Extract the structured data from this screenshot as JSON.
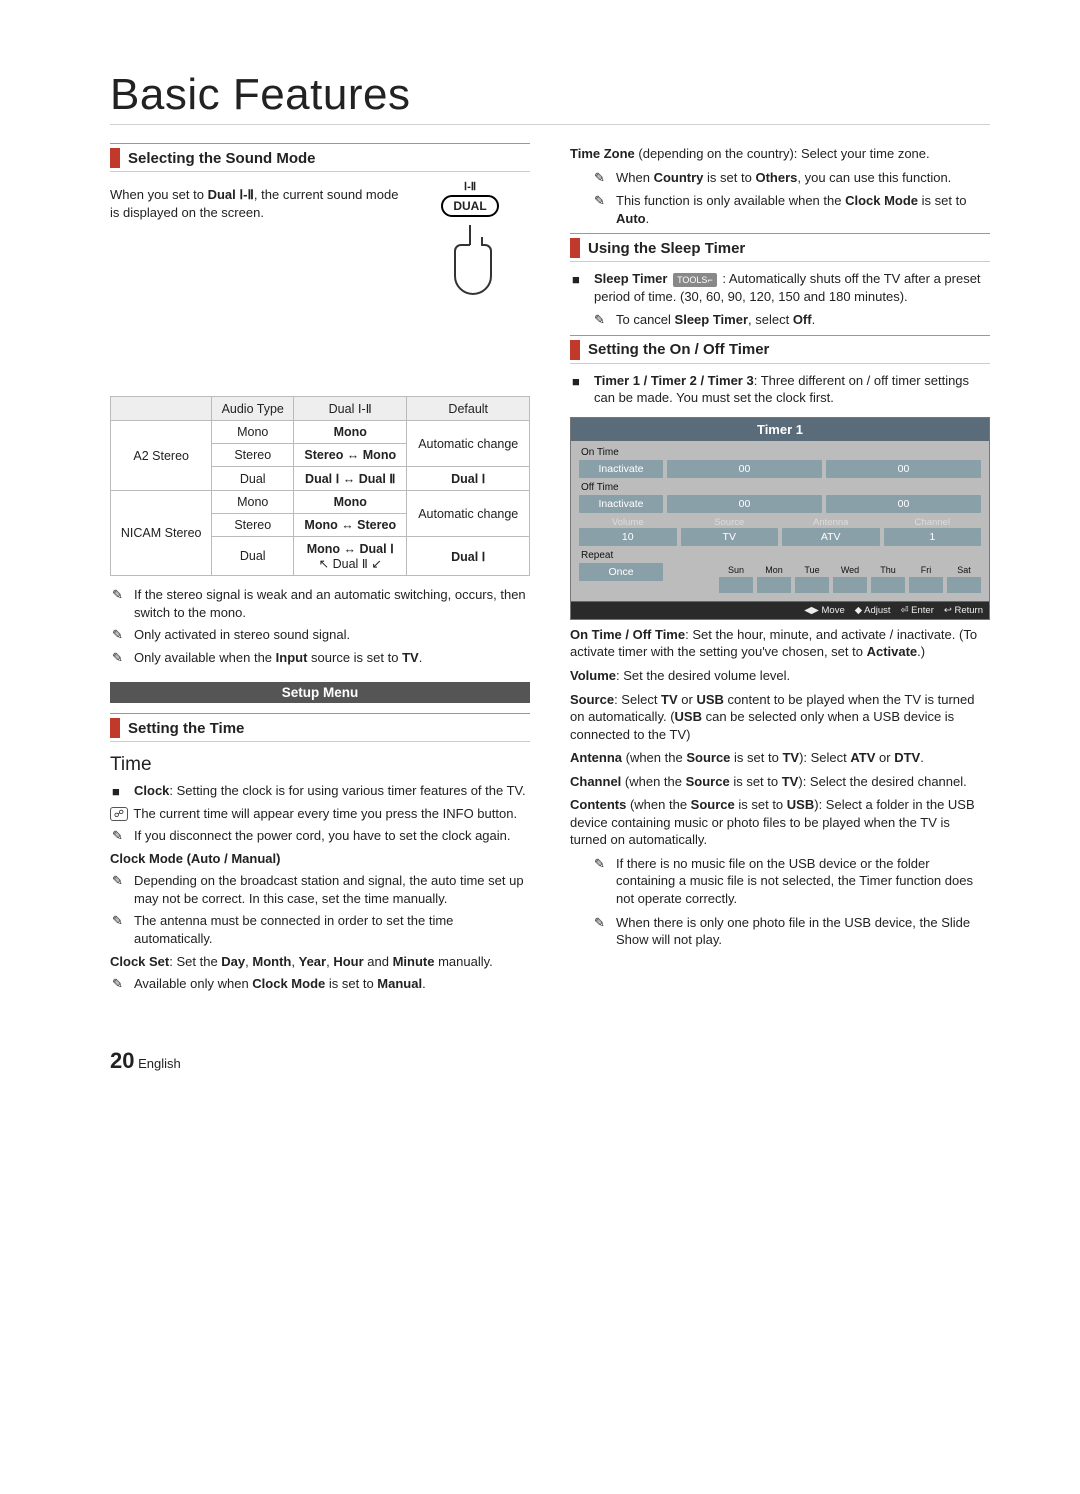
{
  "page": {
    "title": "Basic Features",
    "number": "20",
    "language": "English"
  },
  "dual": {
    "heading": "Selecting the Sound Mode",
    "intro_pre": "When you set to ",
    "intro_bold": "Dual Ⅰ-Ⅱ",
    "intro_post": ", the current sound mode is displayed on the screen.",
    "remote_caption": "Ⅰ-Ⅱ",
    "remote_button": "DUAL",
    "table": {
      "h1": "Audio Type",
      "h2": "Dual Ⅰ-Ⅱ",
      "h3": "Default",
      "sys1": "A2 Stereo",
      "sys2": "NICAM Stereo",
      "r1_at": "Mono",
      "r1_d": "Mono",
      "r1_def": "Automatic change",
      "r2_at": "Stereo",
      "r2_d": "Stereo ↔ Mono",
      "r3_at": "Dual",
      "r3_d": "Dual Ⅰ ↔ Dual Ⅱ",
      "r3_def": "Dual Ⅰ",
      "r4_at": "Mono",
      "r4_d": "Mono",
      "r4_def": "Automatic change",
      "r5_at": "Stereo",
      "r5_d": "Mono ↔ Stereo",
      "r6_at": "Dual",
      "r6_d1": "Mono ↔ Dual Ⅰ",
      "r6_d2": "↖ Dual Ⅱ ↙",
      "r6_def": "Dual Ⅰ"
    },
    "n1": "If the stereo signal is weak and an automatic switching, occurs, then switch to the mono.",
    "n2": "Only activated in stereo sound signal.",
    "n3_pre": "Only available when the ",
    "n3_b": "Input",
    "n3_mid": " source is set to ",
    "n3_b2": "TV",
    "n3_post": "."
  },
  "setup": {
    "banner": "Setup Menu",
    "setting_time": "Setting the Time",
    "time_h": "Time",
    "clock_b": "Clock",
    "clock_txt": ": Setting the clock is for using various timer features of the TV.",
    "info_n": "The current time will appear every time you press the INFO button.",
    "disc_n": "If you disconnect the power cord, you have to set the clock again.",
    "cmode_b": "Clock Mode (Auto / Manual)",
    "cmode_n1": "Depending on the broadcast station and signal, the auto time set up may not be correct. In this case, set the time manually.",
    "cmode_n2": "The antenna must be connected in order to set the time automatically.",
    "cset_pre": "Clock Set",
    "cset_txt1": ": Set the ",
    "cset_day": "Day",
    "cset_c1": ", ",
    "cset_month": "Month",
    "cset_c2": ", ",
    "cset_year": "Year",
    "cset_c3": ", ",
    "cset_hour": "Hour",
    "cset_c4": " and ",
    "cset_min": "Minute",
    "cset_txt2": " manually.",
    "cset_n_pre": "Available only when ",
    "cset_n_b": "Clock Mode",
    "cset_n_mid": " is set to ",
    "cset_n_b2": "Manual",
    "cset_n_post": "."
  },
  "tz": {
    "l1_b": "Time Zone",
    "l1_txt": " (depending on the country): Select your time zone.",
    "n1_pre": "When ",
    "n1_b1": "Country",
    "n1_mid": " is set to ",
    "n1_b2": "Others",
    "n1_post": ", you can use this function.",
    "n2_pre": "This function is only available when the ",
    "n2_b": "Clock Mode",
    "n2_mid": " is set to ",
    "n2_b2": "Auto",
    "n2_post": "."
  },
  "sleep": {
    "heading": "Using the Sleep Timer",
    "b1": "Sleep Timer",
    "tools": "TOOLS⌐",
    "txt": ": Automatically shuts off the TV after a preset period of time. (30, 60, 90, 120, 150 and 180 minutes).",
    "n_pre": "To cancel ",
    "n_b": "Sleep Timer",
    "n_mid": ", select ",
    "n_b2": "Off",
    "n_post": "."
  },
  "onoff": {
    "heading": "Setting the On / Off Timer",
    "b1": "Timer 1 / Timer 2 / Timer 3",
    "b1_txt": ": Three different on / off timer settings can be made. You must set the clock first.",
    "osd": {
      "title": "Timer 1",
      "ontime": "On Time",
      "offtime": "Off Time",
      "inactivate": "Inactivate",
      "zero": "00",
      "volume": "Volume",
      "source": "Source",
      "antenna": "Antenna",
      "channel": "Channel",
      "v_vol": "10",
      "v_src": "TV",
      "v_ant": "ATV",
      "v_ch": "1",
      "repeat": "Repeat",
      "once": "Once",
      "days": [
        "Sun",
        "Mon",
        "Tue",
        "Wed",
        "Thu",
        "Fri",
        "Sat"
      ],
      "legend_move": "◀▶ Move",
      "legend_adj": "◆ Adjust",
      "legend_enter": "⏎ Enter",
      "legend_ret": "↩ Return"
    },
    "p_onoff_b": "On Time / Off Time",
    "p_onoff_t": ": Set the hour, minute, and activate / inactivate. (To activate timer with the setting you've chosen, set to ",
    "p_onoff_b2": "Activate",
    "p_onoff_t2": ".)",
    "p_vol_b": "Volume",
    "p_vol_t": ": Set the desired volume level.",
    "p_src_b": "Source",
    "p_src_t": ": Select ",
    "p_src_b2": "TV",
    "p_src_t2": " or ",
    "p_src_b3": "USB",
    "p_src_t3": " content to be played when the TV is turned on automatically. (",
    "p_src_b4": "USB",
    "p_src_t4": " can be selected only when a USB device is connected to the TV)",
    "p_ant_b": "Antenna",
    "p_ant_t": " (when the ",
    "p_ant_b2": "Source",
    "p_ant_t2": " is set to ",
    "p_ant_b3": "TV",
    "p_ant_t3": "): Select ",
    "p_ant_b4": "ATV",
    "p_ant_t4": " or ",
    "p_ant_b5": "DTV",
    "p_ant_t5": ".",
    "p_ch_b": "Channel",
    "p_ch_t": " (when the ",
    "p_ch_b2": "Source",
    "p_ch_t2": " is set to ",
    "p_ch_b3": "TV",
    "p_ch_t3": "): Select the desired channel.",
    "p_ct_b": "Contents",
    "p_ct_t": " (when the ",
    "p_ct_b2": "Source",
    "p_ct_t2": " is set to ",
    "p_ct_b3": "USB",
    "p_ct_t3": "): Select a folder in the USB device containing music or photo files to be played when the TV is turned on automatically.",
    "n1": "If there is no music file on the USB device or the folder containing a music file is not selected, the Timer function does not operate correctly.",
    "n2": "When there is only one photo file in the USB device, the Slide Show will not play."
  }
}
